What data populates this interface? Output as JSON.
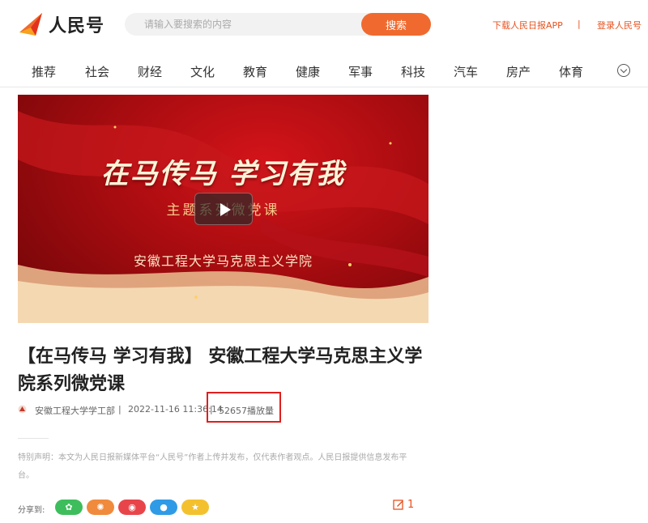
{
  "header": {
    "logo_text": "人民号",
    "search_placeholder": "请输入要搜索的内容",
    "search_button": "搜索",
    "download_app": "下载人民日报APP",
    "separator": "|",
    "login": "登录人民号",
    "brand_color": "#f06a2f"
  },
  "nav": {
    "items": [
      "推荐",
      "社会",
      "财经",
      "文化",
      "教育",
      "健康",
      "军事",
      "科技",
      "汽车",
      "房产",
      "体育"
    ]
  },
  "video": {
    "title": "在马传马 学习有我",
    "subtitle": "主题系列微党课",
    "school": "安徽工程大学马克思主义学院"
  },
  "article": {
    "title": "【在马传马 学习有我】 安徽工程大学马克思主义学院系列微党课",
    "author": "安徽工程大学学工部",
    "separator": "|",
    "date": "2022-11-16 11:36:14",
    "views": "52657播放量",
    "notice": "特别声明：本文为人民日报新媒体平台“人民号”作者上传并发布，仅代表作者观点。人民日报提供信息发布平台。"
  },
  "share": {
    "label": "分享到:",
    "buttons": [
      {
        "name": "wechat",
        "icon": "wechat-icon",
        "glyph": "✿"
      },
      {
        "name": "moments",
        "icon": "moments-icon",
        "glyph": "✺"
      },
      {
        "name": "weibo",
        "icon": "weibo-icon",
        "glyph": "◉"
      },
      {
        "name": "qq",
        "icon": "qq-icon",
        "glyph": "●"
      },
      {
        "name": "qzone",
        "icon": "qzone-icon",
        "glyph": "★"
      }
    ],
    "comment_count": "1"
  }
}
